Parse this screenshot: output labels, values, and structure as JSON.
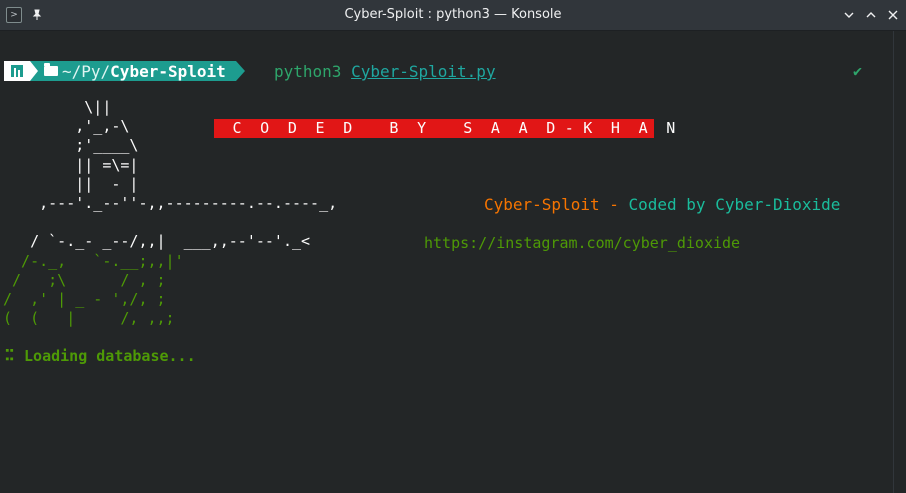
{
  "window": {
    "title": "Cyber-Sploit : python3 — Konsole",
    "app_icon": "terminal-icon",
    "pin_icon": "pin-icon",
    "controls": [
      "chevron-down-icon",
      "chevron-up-icon",
      "close-icon"
    ]
  },
  "prompt": {
    "path_prefix": "~/Py/",
    "path_current": "Cyber-Sploit",
    "command": "python3",
    "argument": "Cyber-Sploit.py",
    "status_icon": "✔"
  },
  "ascii_art": {
    "white": "         \\||\n        ,'_,-\\\n        ;'____\\\n        || =\\=|\n        ||  - |\n    ,---'._--''-,,---------.--.----_,\n\n   / `-._- _--/,,|  ___,,--'--'._<",
    "green": "  /-._,   `-.__;,,|'\n /   ;\\      / , ;\n/  ,' | _ - ',/, ;\n(  (   |     /, ,,;"
  },
  "banner": "  C  O  D  E  D    B  Y    S  A  A  D - K  H  A  N",
  "credit": {
    "name": "Cyber-Sploit",
    "dash": " - ",
    "tagline": "Coded by Cyber-Dioxide"
  },
  "link": "https://instagram.com/cyber_dioxide",
  "status": {
    "spinner": "⠭",
    "text": " Loading database..."
  },
  "colors": {
    "background": "#232627",
    "banner_red": "#e11616",
    "accent_teal": "#1d9c8f",
    "green": "#4e9a06",
    "orange": "#f67400"
  }
}
